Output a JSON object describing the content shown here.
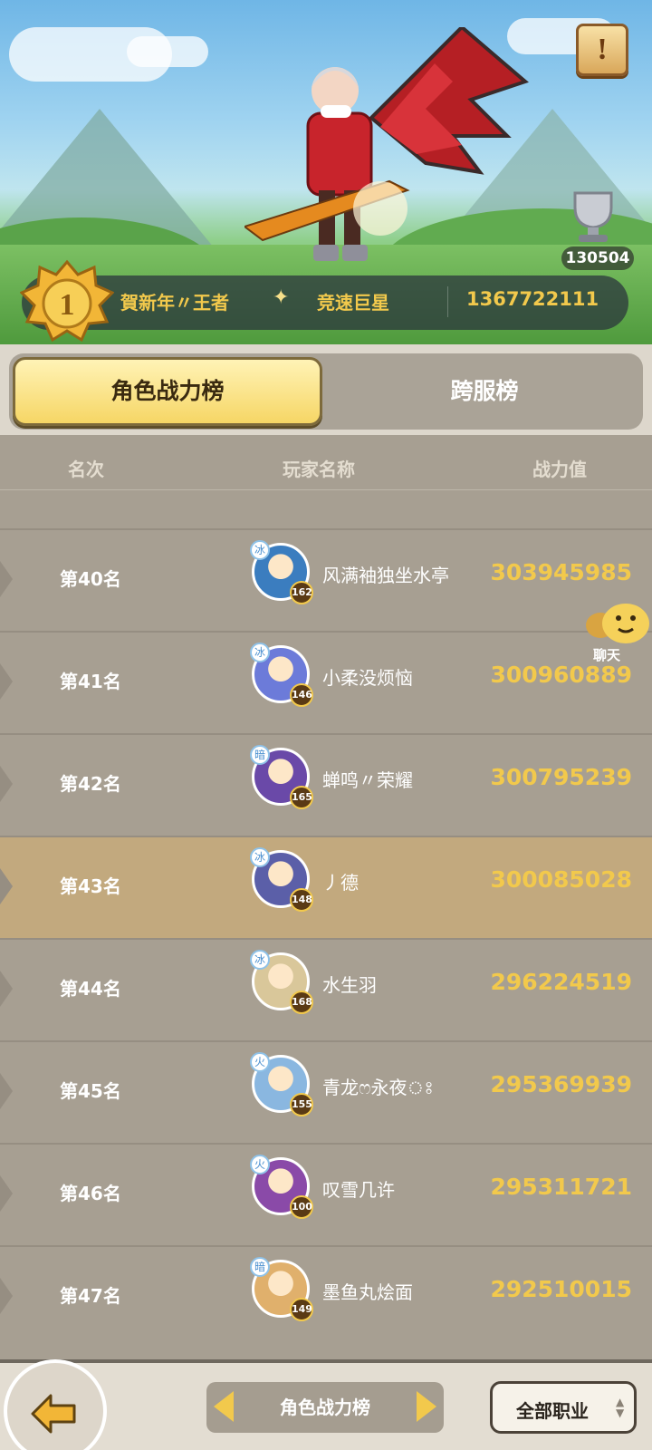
{
  "hero": {
    "trophy_count": "130504",
    "top_player": {
      "rank": "1",
      "name": "賀新年〃王者",
      "sparkle": "✦",
      "title": "竞速巨星",
      "power": "1367722111"
    }
  },
  "tabs": [
    {
      "label": "角色战力榜",
      "active": true
    },
    {
      "label": "跨服榜",
      "active": false
    }
  ],
  "columns": {
    "rank": "名次",
    "name": "玩家名称",
    "power": "战力值"
  },
  "rows": [
    {
      "rank": "第40名",
      "name": "风满袖独坐水亭",
      "power": "303945985",
      "level": "162",
      "element": "冰",
      "highlight": false,
      "avatar_color": "#3b7dbf"
    },
    {
      "rank": "第41名",
      "name": "小柔没烦恼",
      "power": "300960889",
      "level": "146",
      "element": "冰",
      "highlight": false,
      "avatar_color": "#6c7bd9"
    },
    {
      "rank": "第42名",
      "name": "蝉鸣〃荣耀",
      "power": "300795239",
      "level": "165",
      "element": "暗",
      "highlight": false,
      "avatar_color": "#6a49a8"
    },
    {
      "rank": "第43名",
      "name": "丿德",
      "power": "300085028",
      "level": "148",
      "element": "冰",
      "highlight": true,
      "avatar_color": "#5b5fa8"
    },
    {
      "rank": "第44名",
      "name": "水生羽",
      "power": "296224519",
      "level": "168",
      "element": "冰",
      "highlight": false,
      "avatar_color": "#d9c79a"
    },
    {
      "rank": "第45名",
      "name": "青龙ෆ永夜ঃ",
      "power": "295369939",
      "level": "155",
      "element": "火",
      "highlight": false,
      "avatar_color": "#8ab7e0"
    },
    {
      "rank": "第46名",
      "name": "叹雪几许",
      "power": "295311721",
      "level": "100",
      "element": "火",
      "highlight": false,
      "avatar_color": "#8a4aa8"
    },
    {
      "rank": "第47名",
      "name": "墨鱼丸烩面",
      "power": "292510015",
      "level": "149",
      "element": "暗",
      "highlight": false,
      "avatar_color": "#e0b06c"
    }
  ],
  "chat": {
    "label": "聊天"
  },
  "bottom": {
    "selector_label": "角色战力榜",
    "class_filter": "全部职业"
  },
  "colors": {
    "gold": "#f2c94c",
    "panel": "#a79f92",
    "highlight": "#c2a97e"
  }
}
